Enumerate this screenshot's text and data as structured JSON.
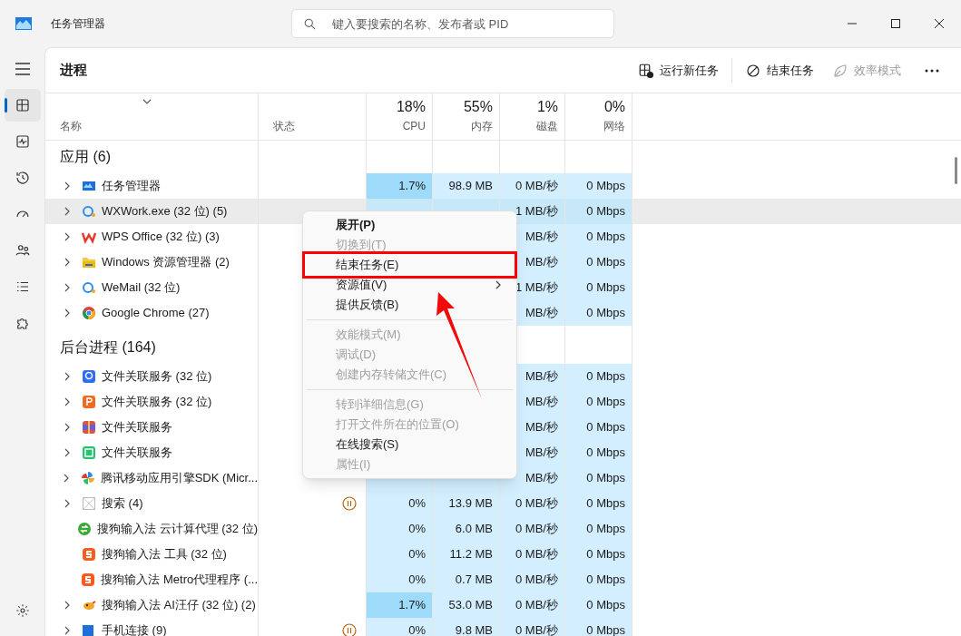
{
  "window": {
    "title": "任务管理器"
  },
  "search": {
    "placeholder": "键入要搜索的名称、发布者或 PID"
  },
  "nav": [
    {
      "kind": "processes",
      "selected": true
    },
    {
      "kind": "performance",
      "selected": false
    },
    {
      "kind": "history",
      "selected": false
    },
    {
      "kind": "startup",
      "selected": false
    },
    {
      "kind": "users",
      "selected": false
    },
    {
      "kind": "details",
      "selected": false
    },
    {
      "kind": "services",
      "selected": false
    }
  ],
  "page_title": "进程",
  "toolbar": [
    {
      "kind": "run",
      "label": "运行新任务",
      "disabled": false
    },
    {
      "kind": "end",
      "label": "结束任务",
      "disabled": false
    },
    {
      "kind": "eco",
      "label": "效率模式",
      "disabled": true
    }
  ],
  "columns": [
    {
      "label": "名称"
    },
    {
      "label": "状态"
    },
    {
      "label": "CPU",
      "percent": "18%"
    },
    {
      "label": "内存",
      "percent": "55%"
    },
    {
      "label": "磁盘",
      "percent": "1%"
    },
    {
      "label": "网络",
      "percent": "0%"
    }
  ],
  "groups": [
    {
      "title": "应用 (6)",
      "rows": [
        {
          "kind": "monitor",
          "name": "任务管理器",
          "expandable": true,
          "selected": false,
          "suspended": false,
          "cpu_high": true,
          "cpu": "1.7%",
          "memory": "98.9 MB",
          "disk": "0 MB/秒",
          "network": "0 Mbps"
        },
        {
          "kind": "chat",
          "name": "WXWork.exe (32 位) (5)",
          "expandable": true,
          "selected": true,
          "suspended": false,
          "disk": "1 MB/秒",
          "network": "0 Mbps"
        },
        {
          "kind": "wps",
          "name": "WPS Office (32 位) (3)",
          "expandable": true,
          "selected": false,
          "suspended": false,
          "disk": "MB/秒",
          "network": "0 Mbps"
        },
        {
          "kind": "folder",
          "name": "Windows 资源管理器 (2)",
          "expandable": true,
          "selected": false,
          "suspended": false,
          "disk": "MB/秒",
          "network": "0 Mbps"
        },
        {
          "kind": "chat",
          "name": "WeMail (32 位)",
          "expandable": true,
          "selected": false,
          "suspended": false,
          "disk": "1 MB/秒",
          "network": "0 Mbps"
        },
        {
          "kind": "chrome",
          "name": "Google Chrome (27)",
          "expandable": true,
          "selected": false,
          "suspended": false,
          "disk": "MB/秒",
          "network": "0 Mbps"
        }
      ]
    },
    {
      "title": "后台进程 (164)",
      "rows": [
        {
          "kind": "player",
          "name": "文件关联服务 (32 位)",
          "expandable": true,
          "selected": false,
          "suspended": false,
          "disk": "MB/秒",
          "network": "0 Mbps"
        },
        {
          "kind": "pdf",
          "name": "文件关联服务 (32 位)",
          "expandable": true,
          "selected": false,
          "suspended": false,
          "disk": "MB/秒",
          "network": "0 Mbps"
        },
        {
          "kind": "archive",
          "name": "文件关联服务",
          "expandable": true,
          "selected": false,
          "suspended": false,
          "disk": "MB/秒",
          "network": "0 Mbps"
        },
        {
          "kind": "note",
          "name": "文件关联服务",
          "expandable": true,
          "selected": false,
          "suspended": false,
          "disk": "MB/秒",
          "network": "0 Mbps"
        },
        {
          "kind": "pinwheel",
          "name": "腾讯移动应用引擎SDK (Micr...",
          "expandable": true,
          "selected": false,
          "suspended": false,
          "disk": "MB/秒",
          "network": "0 Mbps"
        },
        {
          "kind": "blank",
          "name": "搜索 (4)",
          "expandable": true,
          "selected": false,
          "suspended": true,
          "cpu_high": false,
          "cpu": "0%",
          "memory": "13.9 MB",
          "disk": "0 MB/秒",
          "network": "0 Mbps"
        },
        {
          "kind": "cloud",
          "name": "搜狗输入法 云计算代理 (32 位)",
          "expandable": false,
          "selected": false,
          "suspended": false,
          "cpu_high": false,
          "cpu": "0%",
          "memory": "6.0 MB",
          "disk": "0 MB/秒",
          "network": "0 Mbps"
        },
        {
          "kind": "sogou",
          "name": "搜狗输入法 工具 (32 位)",
          "expandable": false,
          "selected": false,
          "suspended": false,
          "cpu_high": false,
          "cpu": "0%",
          "memory": "11.2 MB",
          "disk": "0 MB/秒",
          "network": "0 Mbps"
        },
        {
          "kind": "sogou",
          "name": "搜狗输入法 Metro代理程序 (...",
          "expandable": false,
          "selected": false,
          "suspended": false,
          "cpu_high": false,
          "cpu": "0%",
          "memory": "0.7 MB",
          "disk": "0 MB/秒",
          "network": "0 Mbps"
        },
        {
          "kind": "dog",
          "name": "搜狗输入法 AI汪仔 (32 位) (2)",
          "expandable": true,
          "selected": false,
          "suspended": false,
          "cpu_high": true,
          "cpu": "1.7%",
          "memory": "53.0 MB",
          "disk": "0 MB/秒",
          "network": "0 Mbps"
        },
        {
          "kind": "phone",
          "name": "手机连接 (9)",
          "expandable": true,
          "selected": false,
          "suspended": true,
          "cpu_high": false,
          "cpu": "0%",
          "memory": "9.8 MB",
          "disk": "0 MB/秒",
          "network": "0 Mbps"
        }
      ]
    }
  ],
  "context_menu": [
    {
      "kind": "item",
      "label": "展开(P)",
      "bold": true,
      "disabled": false,
      "submenu": false,
      "highlighted": false
    },
    {
      "kind": "item",
      "label": "切换到(T)",
      "bold": false,
      "disabled": true,
      "submenu": false,
      "highlighted": false
    },
    {
      "kind": "item",
      "label": "结束任务(E)",
      "bold": false,
      "disabled": false,
      "submenu": false,
      "highlighted": true
    },
    {
      "kind": "item",
      "label": "资源值(V)",
      "bold": false,
      "disabled": false,
      "submenu": true,
      "highlighted": false
    },
    {
      "kind": "item",
      "label": "提供反馈(B)",
      "bold": false,
      "disabled": false,
      "submenu": false,
      "highlighted": false
    },
    {
      "kind": "separator"
    },
    {
      "kind": "item",
      "label": "效能模式(M)",
      "bold": false,
      "disabled": true,
      "submenu": false,
      "highlighted": false
    },
    {
      "kind": "item",
      "label": "调试(D)",
      "bold": false,
      "disabled": true,
      "submenu": false,
      "highlighted": false
    },
    {
      "kind": "item",
      "label": "创建内存转储文件(C)",
      "bold": false,
      "disabled": true,
      "submenu": false,
      "highlighted": false
    },
    {
      "kind": "separator"
    },
    {
      "kind": "item",
      "label": "转到详细信息(G)",
      "bold": false,
      "disabled": true,
      "submenu": false,
      "highlighted": false
    },
    {
      "kind": "item",
      "label": "打开文件所在的位置(O)",
      "bold": false,
      "disabled": true,
      "submenu": false,
      "highlighted": false
    },
    {
      "kind": "item",
      "label": "在线搜索(S)",
      "bold": false,
      "disabled": false,
      "submenu": false,
      "highlighted": false
    },
    {
      "kind": "item",
      "label": "属性(I)",
      "bold": false,
      "disabled": true,
      "submenu": false,
      "highlighted": false
    }
  ]
}
